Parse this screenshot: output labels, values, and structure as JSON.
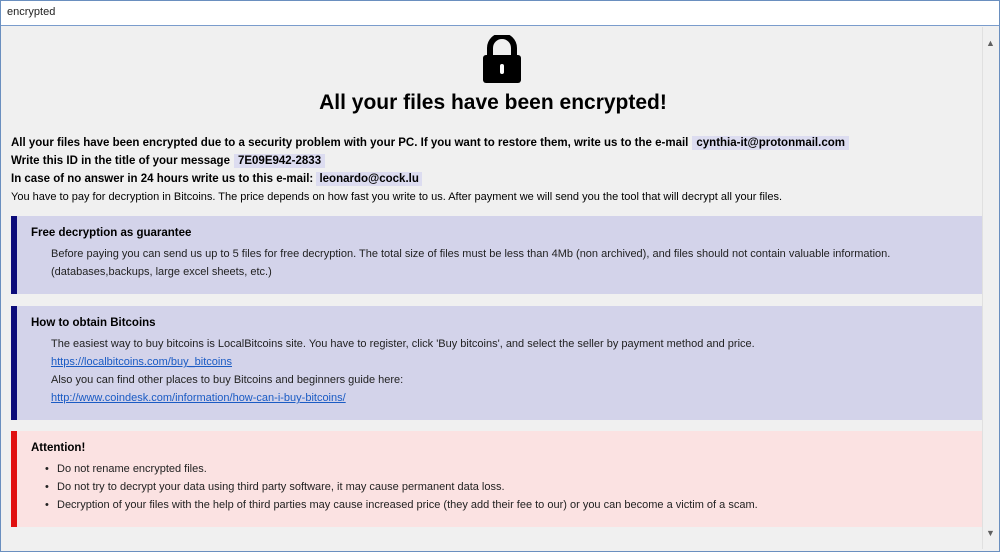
{
  "window": {
    "title": "encrypted"
  },
  "headline": "All your files have been encrypted!",
  "intro": {
    "line1_text": "All your files have been encrypted due to a security problem with your PC. If you want to restore them, write us to the e-mail",
    "line1_email": "cynthia-it@protonmail.com",
    "line2_text": "Write this ID in the title of your message",
    "line2_id": "7E09E942-2833",
    "line3_text": "In case of no answer in 24 hours write us to this e-mail:",
    "line3_email": "leonardo@cock.lu",
    "line4_text": "You have to pay for decryption in Bitcoins. The price depends on how fast you write to us. After payment we will send you the tool that will decrypt all your files."
  },
  "guarantee": {
    "title": "Free decryption as guarantee",
    "text": "Before paying you can send us up to 5 files for free decryption. The total size of files must be less than 4Mb (non archived), and files should not contain valuable information. (databases,backups, large excel sheets, etc.)"
  },
  "bitcoins": {
    "title": "How to obtain Bitcoins",
    "line1": "The easiest way to buy bitcoins is LocalBitcoins site. You have to register, click 'Buy bitcoins', and select the seller by payment method and price.",
    "link1": "https://localbitcoins.com/buy_bitcoins",
    "line2": "Also you can find other places to buy Bitcoins and beginners guide here:",
    "link2": "http://www.coindesk.com/information/how-can-i-buy-bitcoins/"
  },
  "attention": {
    "title": "Attention!",
    "items": [
      "Do not rename encrypted files.",
      "Do not try to decrypt your data using third party software, it may cause permanent data loss.",
      "Decryption of your files with the help of third parties may cause increased price (they add their fee to our) or you can become a victim of a scam."
    ]
  },
  "colors": {
    "info_bg": "#d3d3ea",
    "info_border": "#0b0b7a",
    "warn_bg": "#fbe2e2",
    "warn_border": "#e01010",
    "link": "#1a5bc4"
  },
  "icons": {
    "lock": "padlock-icon",
    "scroll_up": "chevron-up-icon",
    "scroll_down": "chevron-down-icon"
  }
}
